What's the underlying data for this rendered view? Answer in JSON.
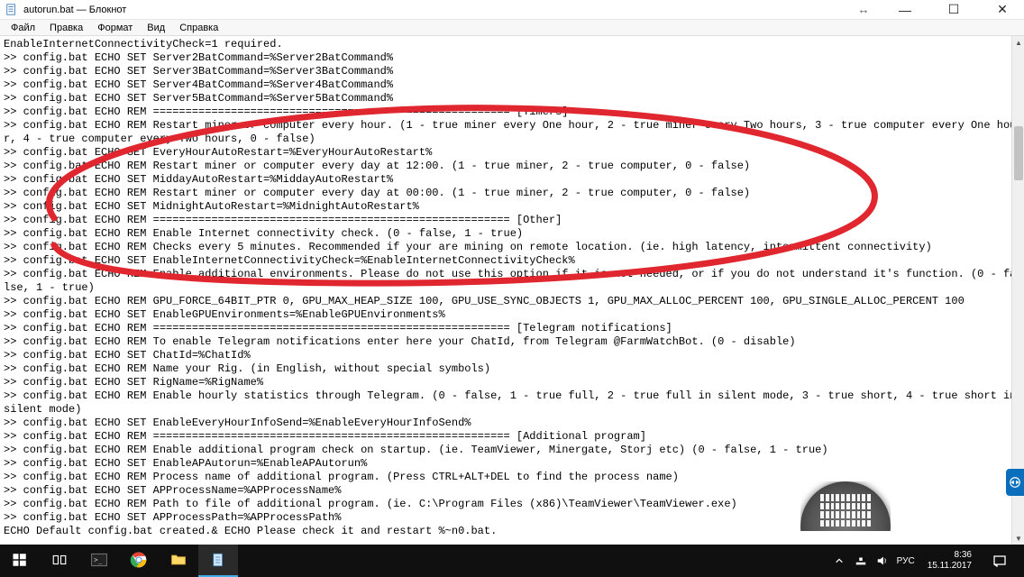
{
  "window": {
    "title": "autorun.bat — Блокнот"
  },
  "win_controls": {
    "sync": "↔",
    "minimize": "―",
    "maximize": "☐",
    "close": "✕"
  },
  "menu": {
    "file": "Файл",
    "edit": "Правка",
    "format": "Формат",
    "view": "Вид",
    "help": "Справка"
  },
  "editor_lines": [
    "EnableInternetConnectivityCheck=1 required.",
    ">> config.bat ECHO SET Server2BatCommand=%Server2BatCommand%",
    ">> config.bat ECHO SET Server3BatCommand=%Server3BatCommand%",
    ">> config.bat ECHO SET Server4BatCommand=%Server4BatCommand%",
    ">> config.bat ECHO SET Server5BatCommand=%Server5BatCommand%",
    ">> config.bat ECHO REM ======================================================= [Timers]",
    ">> config.bat ECHO REM Restart miner or computer every hour. (1 - true miner every One hour, 2 - true miner every Two hours, 3 - true computer every One hour, 4 - true computer every Two hours, 0 - false)",
    ">> config.bat ECHO SET EveryHourAutoRestart=%EveryHourAutoRestart%",
    ">> config.bat ECHO REM Restart miner or computer every day at 12:00. (1 - true miner, 2 - true computer, 0 - false)",
    ">> config.bat ECHO SET MiddayAutoRestart=%MiddayAutoRestart%",
    ">> config.bat ECHO REM Restart miner or computer every day at 00:00. (1 - true miner, 2 - true computer, 0 - false)",
    ">> config.bat ECHO SET MidnightAutoRestart=%MidnightAutoRestart%",
    ">> config.bat ECHO REM ======================================================= [Other]",
    ">> config.bat ECHO REM Enable Internet connectivity check. (0 - false, 1 - true)",
    ">> config.bat ECHO REM Checks every 5 minutes. Recommended if your are mining on remote location. (ie. high latency, intermittent connectivity)",
    ">> config.bat ECHO SET EnableInternetConnectivityCheck=%EnableInternetConnectivityCheck%",
    ">> config.bat ECHO REM Enable additional environments. Please do not use this option if it is not needed, or if you do not understand it's function. (0 - false, 1 - true)",
    ">> config.bat ECHO REM GPU_FORCE_64BIT_PTR 0, GPU_MAX_HEAP_SIZE 100, GPU_USE_SYNC_OBJECTS 1, GPU_MAX_ALLOC_PERCENT 100, GPU_SINGLE_ALLOC_PERCENT 100",
    ">> config.bat ECHO SET EnableGPUEnvironments=%EnableGPUEnvironments%",
    ">> config.bat ECHO REM ======================================================= [Telegram notifications]",
    ">> config.bat ECHO REM To enable Telegram notifications enter here your ChatId, from Telegram @FarmWatchBot. (0 - disable)",
    ">> config.bat ECHO SET ChatId=%ChatId%",
    ">> config.bat ECHO REM Name your Rig. (in English, without special symbols)",
    ">> config.bat ECHO SET RigName=%RigName%",
    ">> config.bat ECHO REM Enable hourly statistics through Telegram. (0 - false, 1 - true full, 2 - true full in silent mode, 3 - true short, 4 - true short in silent mode)",
    ">> config.bat ECHO SET EnableEveryHourInfoSend=%EnableEveryHourInfoSend%",
    ">> config.bat ECHO REM ======================================================= [Additional program]",
    ">> config.bat ECHO REM Enable additional program check on startup. (ie. TeamViewer, Minergate, Storj etc) (0 - false, 1 - true)",
    ">> config.bat ECHO SET EnableAPAutorun=%EnableAPAutorun%",
    ">> config.bat ECHO REM Process name of additional program. (Press CTRL+ALT+DEL to find the process name)",
    ">> config.bat ECHO SET APProcessName=%APProcessName%",
    ">> config.bat ECHO REM Path to file of additional program. (ie. C:\\Program Files (x86)\\TeamViewer\\TeamViewer.exe)",
    ">> config.bat ECHO SET APProcessPath=%APProcessPath%",
    "ECHO Default config.bat created.& ECHO Please check it and restart %~n0.bat."
  ],
  "tray": {
    "lang": "РУС",
    "time": "8:36",
    "date": "15.11.2017"
  },
  "annotation_color": "#e0262e"
}
